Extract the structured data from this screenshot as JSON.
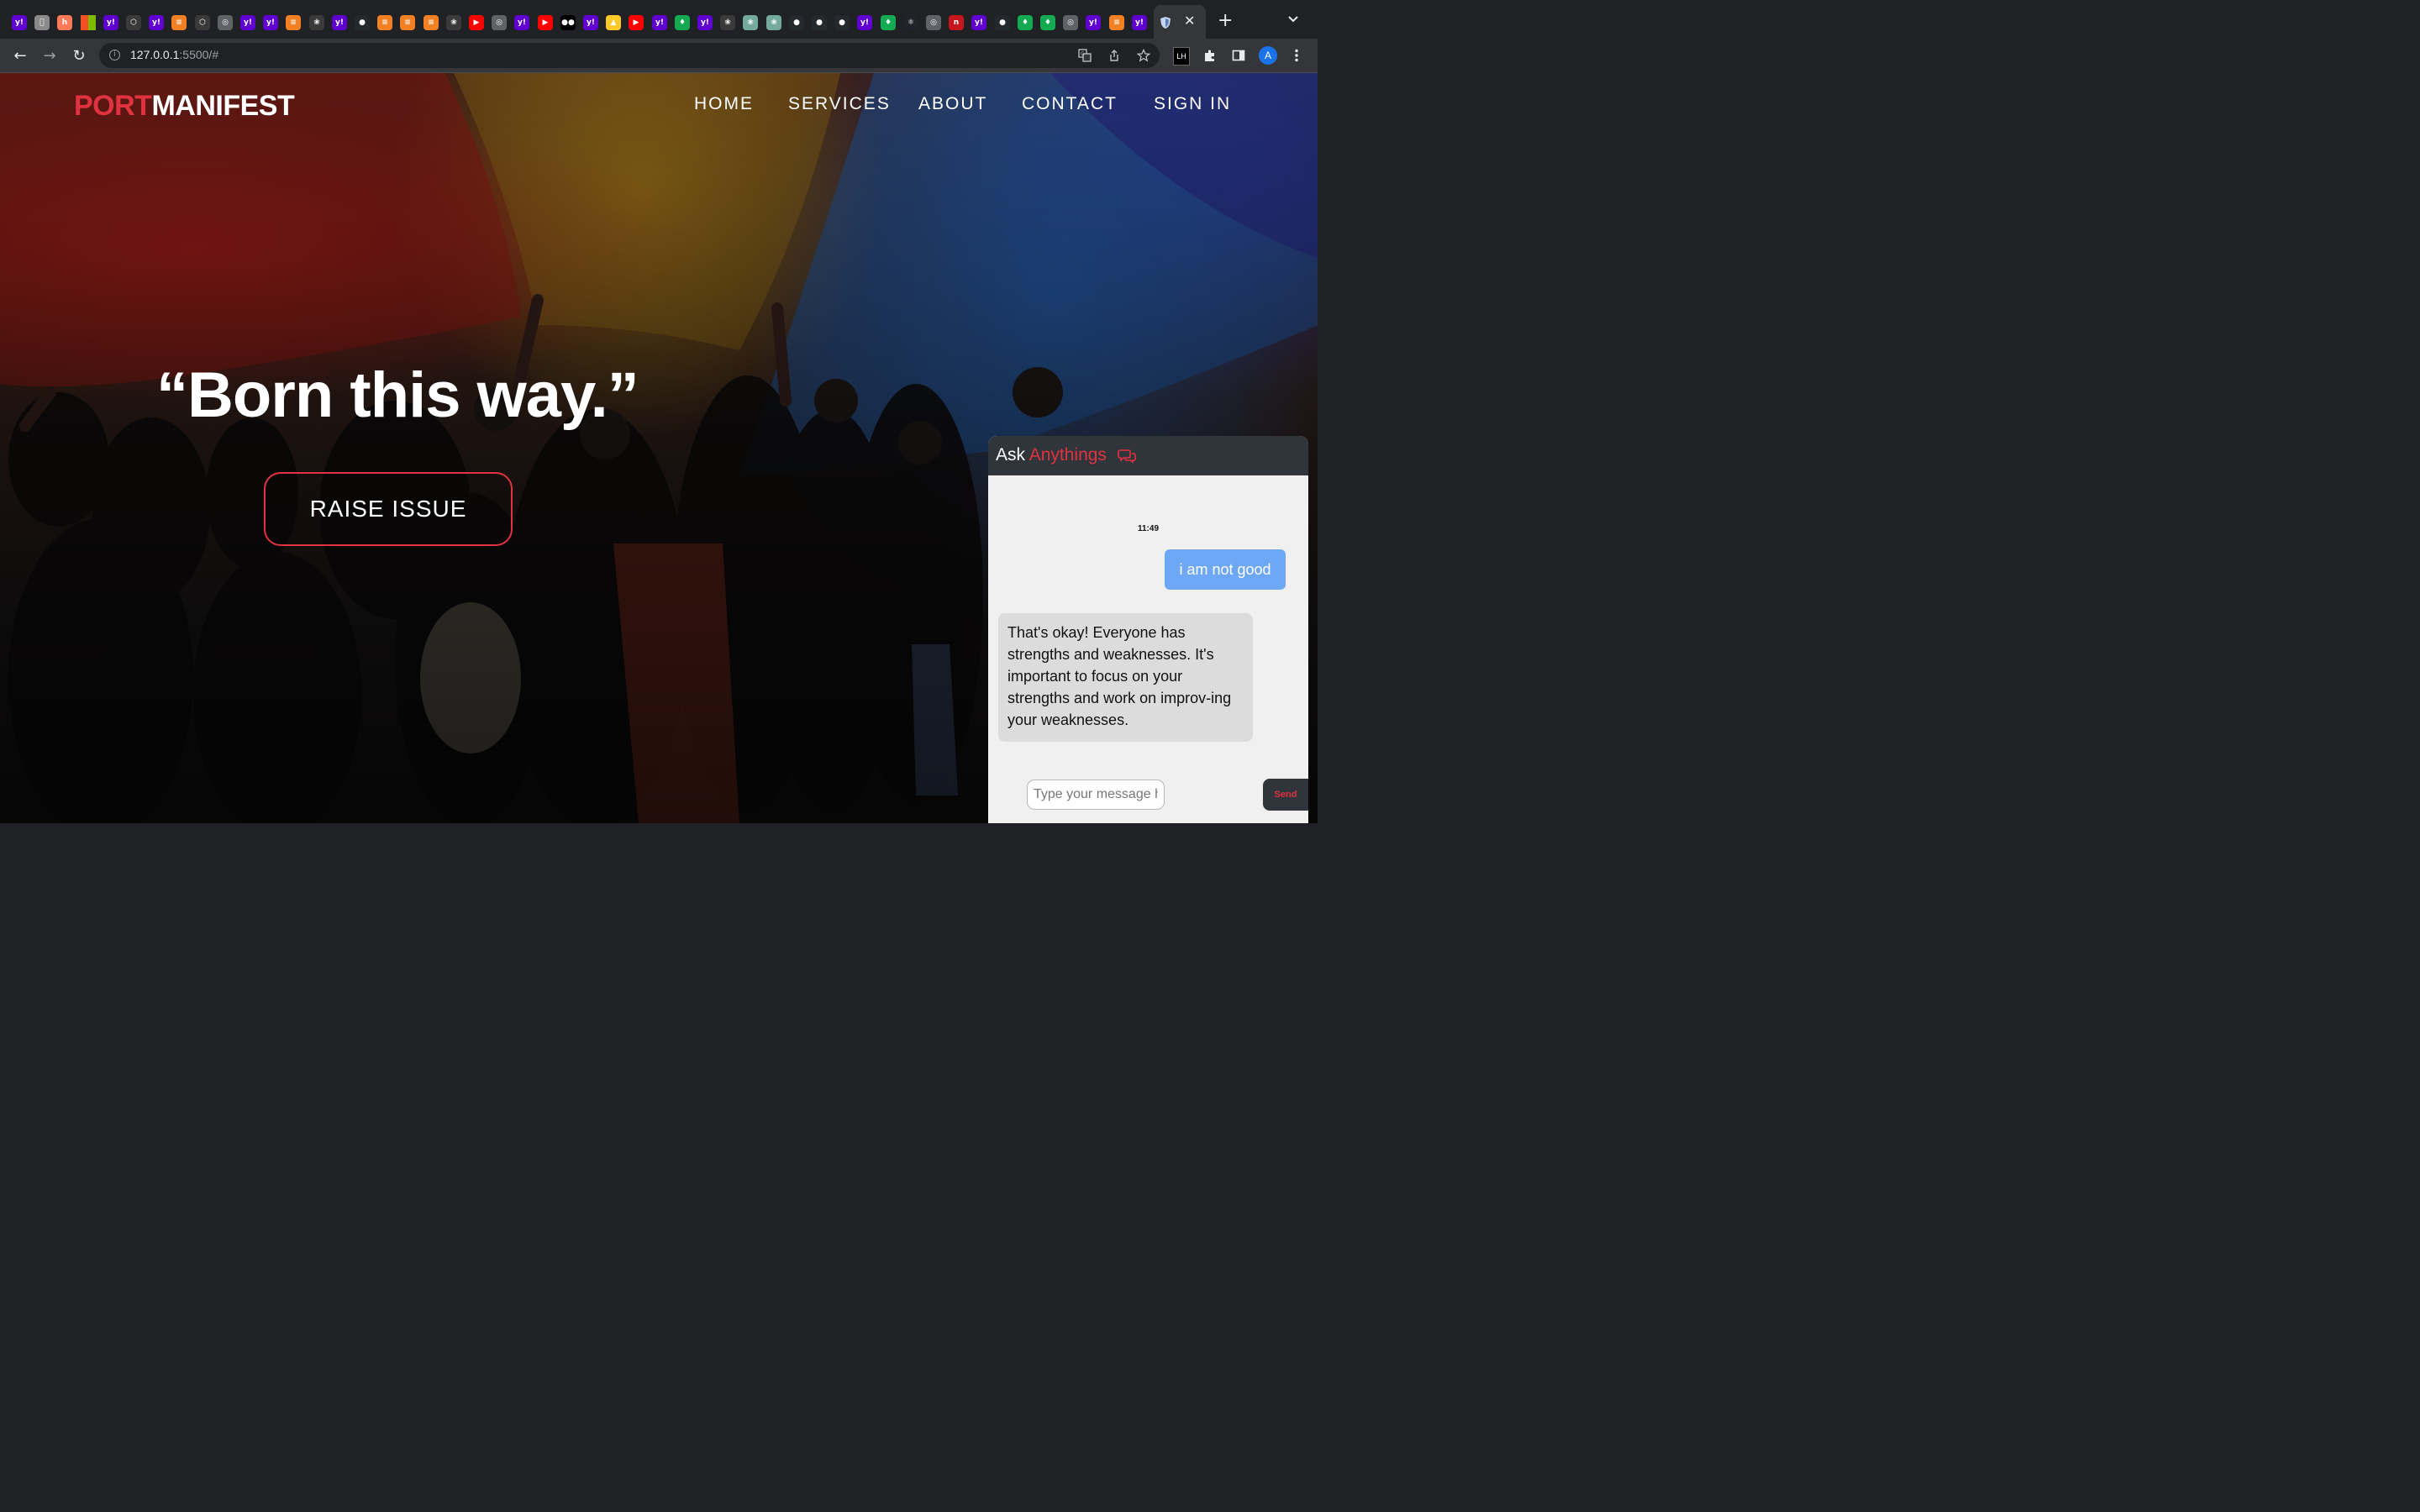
{
  "browser": {
    "tabs": [
      {
        "icon": "yahoo-icon",
        "glyph": "y!",
        "color": "#5f01d1"
      },
      {
        "icon": "apple-icon",
        "glyph": "",
        "color": "#8a8a8a"
      },
      {
        "icon": "hubspot-icon",
        "glyph": "h",
        "color": "#ff7a59"
      },
      {
        "icon": "microsoft-icon",
        "glyph": "",
        "color": "#f25022"
      },
      {
        "icon": "yahoo-icon",
        "glyph": "y!",
        "color": "#5f01d1"
      },
      {
        "icon": "unity-icon",
        "glyph": "⬡",
        "color": "#3a3a3a"
      },
      {
        "icon": "yahoo-icon",
        "glyph": "y!",
        "color": "#5f01d1"
      },
      {
        "icon": "stackoverflow-icon",
        "glyph": "≡",
        "color": "#f48024"
      },
      {
        "icon": "unity-icon",
        "glyph": "⬡",
        "color": "#3a3a3a"
      },
      {
        "icon": "globe-icon",
        "glyph": "◎",
        "color": "#5f6368"
      },
      {
        "icon": "yahoo-icon",
        "glyph": "y!",
        "color": "#5f01d1"
      },
      {
        "icon": "yahoo-icon",
        "glyph": "y!",
        "color": "#5f01d1"
      },
      {
        "icon": "stackoverflow-icon",
        "glyph": "≡",
        "color": "#f48024"
      },
      {
        "icon": "openai-icon",
        "glyph": "❀",
        "color": "#3a3a3a"
      },
      {
        "icon": "yahoo-icon",
        "glyph": "y!",
        "color": "#5f01d1"
      },
      {
        "icon": "github-icon",
        "glyph": "●",
        "color": "#24292e"
      },
      {
        "icon": "stackoverflow-icon",
        "glyph": "≡",
        "color": "#f48024"
      },
      {
        "icon": "stackoverflow-icon",
        "glyph": "≡",
        "color": "#f48024"
      },
      {
        "icon": "stackoverflow-icon",
        "glyph": "≡",
        "color": "#f48024"
      },
      {
        "icon": "openai-icon",
        "glyph": "❀",
        "color": "#3a3a3a"
      },
      {
        "icon": "youtube-icon",
        "glyph": "▶",
        "color": "#ff0000"
      },
      {
        "icon": "globe-icon",
        "glyph": "◎",
        "color": "#5f6368"
      },
      {
        "icon": "yahoo-icon",
        "glyph": "y!",
        "color": "#5f01d1"
      },
      {
        "icon": "youtube-icon",
        "glyph": "▶",
        "color": "#ff0000"
      },
      {
        "icon": "medium-icon",
        "glyph": "●●",
        "color": "#000000"
      },
      {
        "icon": "yahoo-icon",
        "glyph": "y!",
        "color": "#5f01d1"
      },
      {
        "icon": "firebase-icon",
        "glyph": "▲",
        "color": "#ffca28"
      },
      {
        "icon": "youtube-icon",
        "glyph": "▶",
        "color": "#ff0000"
      },
      {
        "icon": "yahoo-icon",
        "glyph": "y!",
        "color": "#5f01d1"
      },
      {
        "icon": "mongodb-icon",
        "glyph": "♦",
        "color": "#13aa52"
      },
      {
        "icon": "yahoo-icon",
        "glyph": "y!",
        "color": "#5f01d1"
      },
      {
        "icon": "openai-icon",
        "glyph": "❀",
        "color": "#3a3a3a"
      },
      {
        "icon": "chatgpt-icon",
        "glyph": "❀",
        "color": "#74aa9c"
      },
      {
        "icon": "chatgpt-icon",
        "glyph": "❀",
        "color": "#74aa9c"
      },
      {
        "icon": "github-icon",
        "glyph": "●",
        "color": "#24292e"
      },
      {
        "icon": "github-icon",
        "glyph": "●",
        "color": "#24292e"
      },
      {
        "icon": "github-icon",
        "glyph": "●",
        "color": "#24292e"
      },
      {
        "icon": "yahoo-icon",
        "glyph": "y!",
        "color": "#5f01d1"
      },
      {
        "icon": "mongodb-icon",
        "glyph": "♦",
        "color": "#13aa52"
      },
      {
        "icon": "react-icon",
        "glyph": "⚛",
        "color": "#20232a"
      },
      {
        "icon": "globe-icon",
        "glyph": "◎",
        "color": "#5f6368"
      },
      {
        "icon": "netlify-icon",
        "glyph": "n",
        "color": "#c4161c"
      },
      {
        "icon": "yahoo-icon",
        "glyph": "y!",
        "color": "#5f01d1"
      },
      {
        "icon": "github-icon",
        "glyph": "●",
        "color": "#24292e"
      },
      {
        "icon": "mongodb-icon",
        "glyph": "♦",
        "color": "#13aa52"
      },
      {
        "icon": "mongodb-icon",
        "glyph": "♦",
        "color": "#13aa52"
      },
      {
        "icon": "globe-icon",
        "glyph": "◎",
        "color": "#5f6368"
      },
      {
        "icon": "yahoo-icon",
        "glyph": "y!",
        "color": "#5f01d1"
      },
      {
        "icon": "stackoverflow-icon",
        "glyph": "≡",
        "color": "#f48024"
      },
      {
        "icon": "yahoo-icon",
        "glyph": "y!",
        "color": "#5f01d1"
      }
    ],
    "active_tab_icon": "shield-icon",
    "close_glyph": "✕",
    "new_tab_glyph": "+",
    "tab_menu_glyph": "⌄",
    "url_host": "127.0.0.1",
    "url_rest": ":5500/#",
    "back_glyph": "←",
    "forward_glyph": "→",
    "reload_glyph": "↻",
    "profile_initial": "A",
    "extension_label": "LH"
  },
  "site": {
    "logo_accent": "PORT",
    "logo_main": "MANIFEST",
    "nav": [
      "HOME",
      "SERVICES",
      "ABOUT",
      "CONTACT",
      "SIGN IN"
    ],
    "hero_quote": "“Born this way.”",
    "cta_label": "RAISE ISSUE",
    "accent_color": "#e0323f"
  },
  "chat": {
    "title_plain": "Ask",
    "title_accent": "Anythings",
    "time": "11:49",
    "user_message": "i am not good",
    "bot_message": "That's okay! Everyone has strengths and weaknesses. It's important to focus on your strengths and work on improv-ing your weaknesses.",
    "input_placeholder": "Type your message here",
    "input_value": "",
    "send_label": "Send"
  }
}
